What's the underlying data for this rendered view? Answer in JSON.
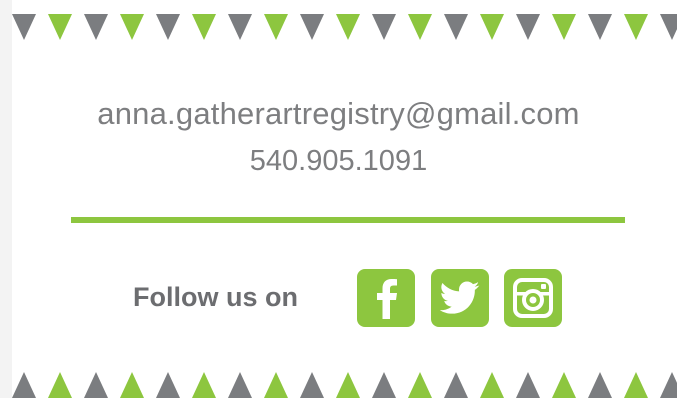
{
  "contact": {
    "email": "anna.gatherartregistry@gmail.com",
    "phone": "540.905.1091"
  },
  "social": {
    "follow_label": "Follow us on",
    "links": [
      {
        "name": "facebook",
        "icon": "facebook-icon"
      },
      {
        "name": "twitter",
        "icon": "twitter-icon"
      },
      {
        "name": "instagram",
        "icon": "instagram-icon"
      }
    ]
  },
  "colors": {
    "accent_green": "#8dc63f",
    "bunting_gray": "#7b7d80",
    "text_gray": "#7d7e80",
    "background": "#ffffff"
  }
}
